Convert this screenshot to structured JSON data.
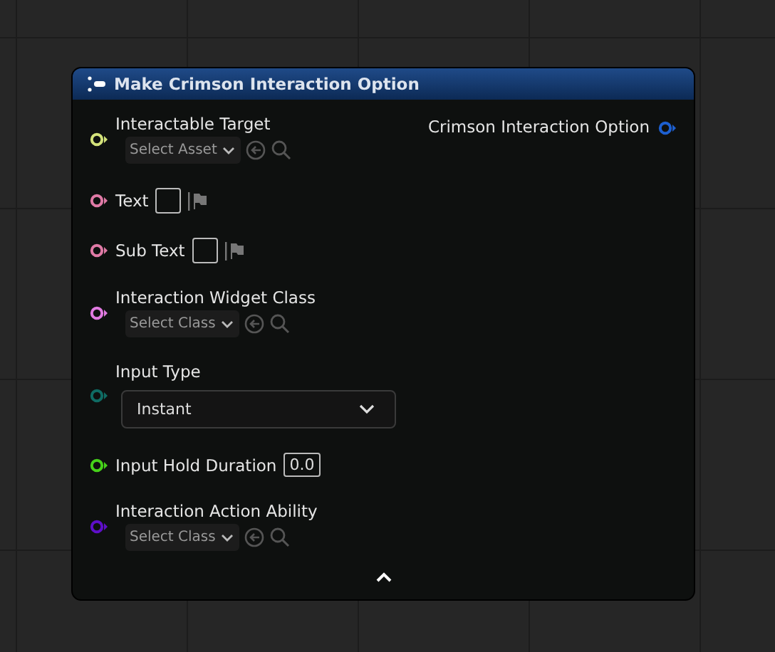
{
  "node": {
    "title": "Make Crimson Interaction Option",
    "output": {
      "label": "Crimson Interaction Option",
      "color": "#1d5fcf"
    },
    "inputs": [
      {
        "label": "Interactable Target",
        "kind": "picker",
        "color": "#d3e27a",
        "value": "Select Asset"
      },
      {
        "label": "Text",
        "kind": "text",
        "color": "#e07aa6"
      },
      {
        "label": "Sub Text",
        "kind": "text",
        "color": "#e07aa6"
      },
      {
        "label": "Interaction Widget Class",
        "kind": "picker",
        "color": "#e07ae0",
        "value": "Select Class"
      },
      {
        "label": "Input Type",
        "kind": "enum",
        "color": "#0f6b63",
        "value": "Instant"
      },
      {
        "label": "Input Hold Duration",
        "kind": "number",
        "color": "#46d11a",
        "value": "0.0"
      },
      {
        "label": "Interaction Action Ability",
        "kind": "picker",
        "color": "#5e0fc8",
        "value": "Select Class"
      }
    ]
  }
}
